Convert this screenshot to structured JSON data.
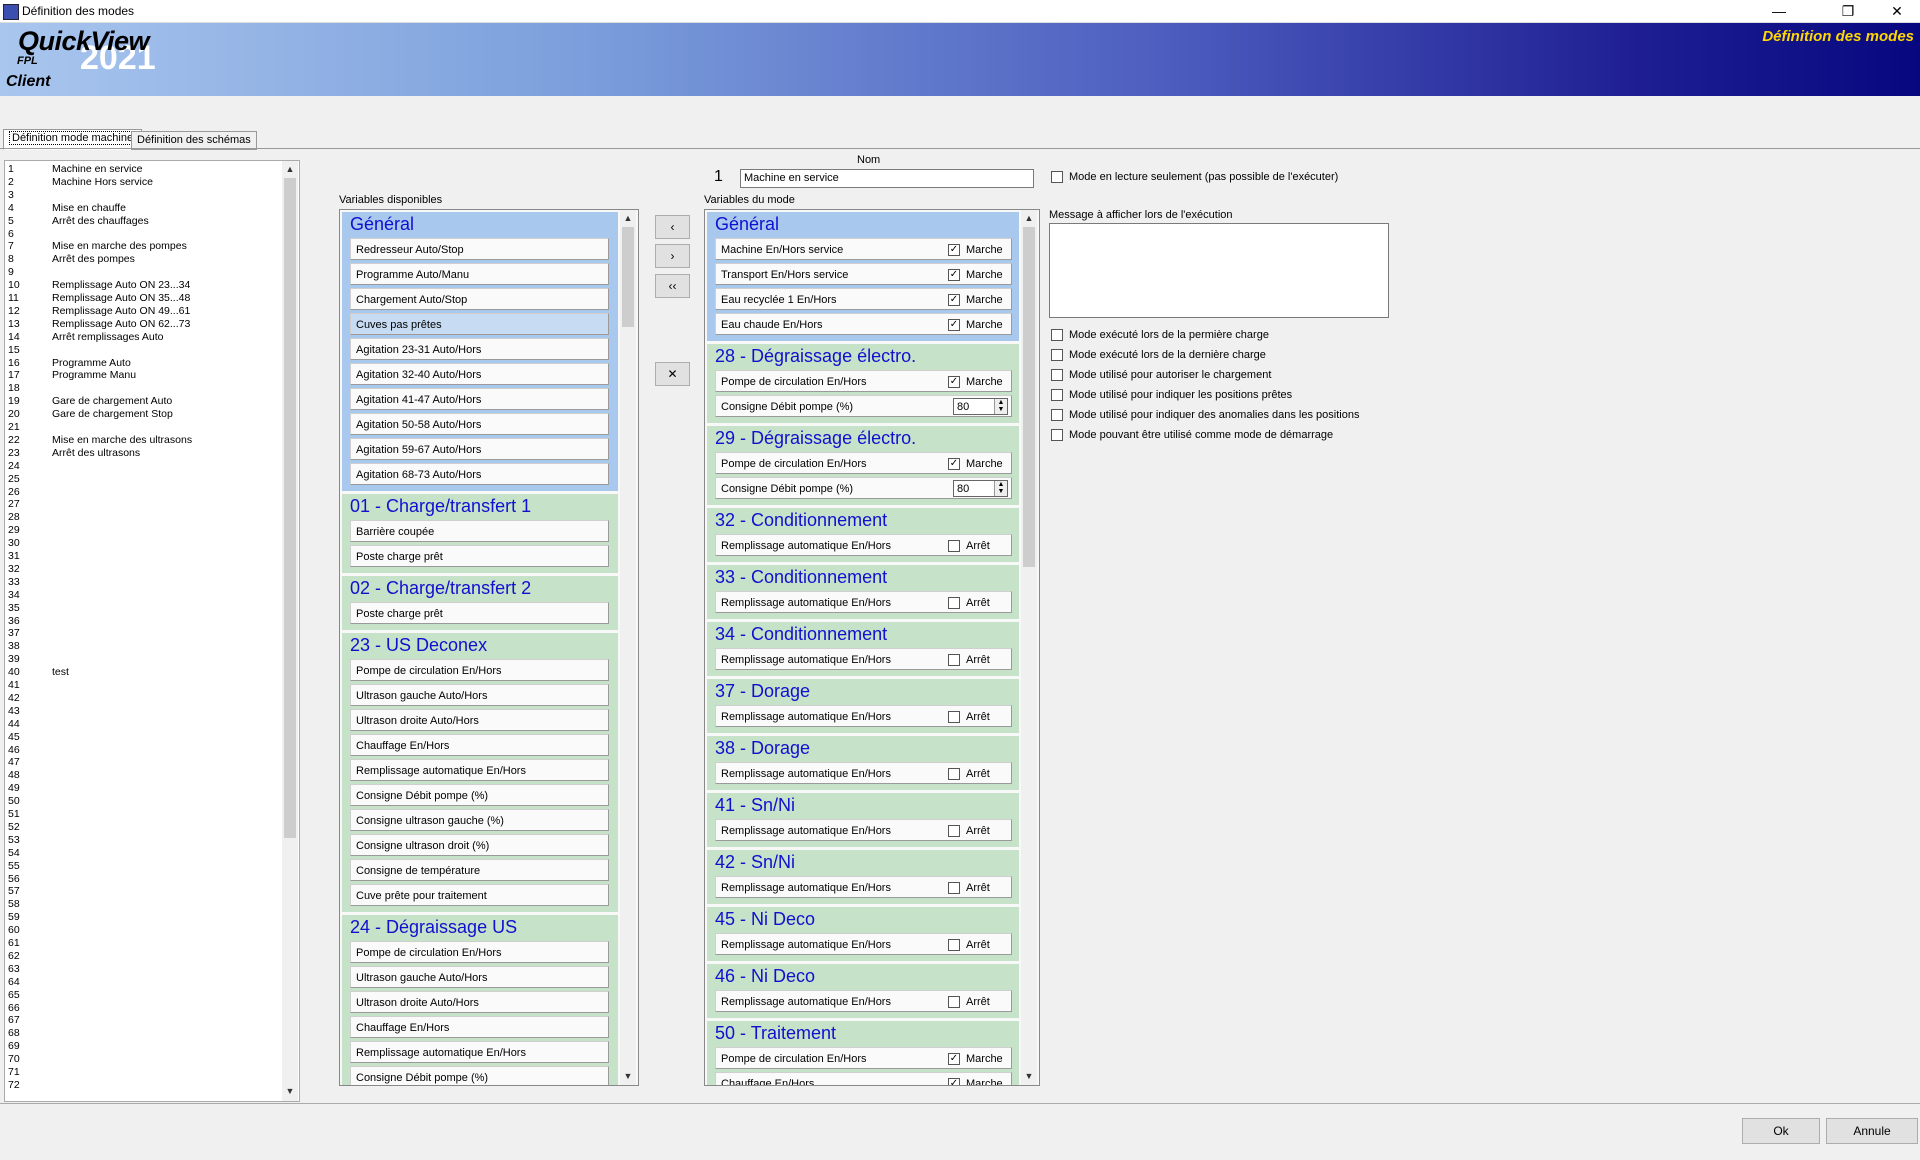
{
  "window": {
    "title": "Définition des modes",
    "minimize": "—",
    "maximize": "❐",
    "close": "✕"
  },
  "banner": {
    "brand": "QuickView",
    "year": "2021",
    "sub": "FPL",
    "role": "Client",
    "page_title": "Définition des modes"
  },
  "tabs": [
    {
      "label": "Définition mode machine"
    },
    {
      "label": "Définition des schémas"
    }
  ],
  "mode_list": [
    {
      "n": "1",
      "name": "Machine en service"
    },
    {
      "n": "2",
      "name": "Machine Hors service"
    },
    {
      "n": "3",
      "name": ""
    },
    {
      "n": "4",
      "name": "Mise en chauffe"
    },
    {
      "n": "5",
      "name": "Arrêt des chauffages"
    },
    {
      "n": "6",
      "name": ""
    },
    {
      "n": "7",
      "name": "Mise en marche des pompes"
    },
    {
      "n": "8",
      "name": "Arrêt des pompes"
    },
    {
      "n": "9",
      "name": ""
    },
    {
      "n": "10",
      "name": "Remplissage Auto ON 23...34"
    },
    {
      "n": "11",
      "name": "Remplissage Auto ON 35...48"
    },
    {
      "n": "12",
      "name": "Remplissage Auto ON 49...61"
    },
    {
      "n": "13",
      "name": "Remplissage Auto ON 62...73"
    },
    {
      "n": "14",
      "name": "Arrêt remplissages Auto"
    },
    {
      "n": "15",
      "name": ""
    },
    {
      "n": "16",
      "name": "Programme Auto"
    },
    {
      "n": "17",
      "name": "Programme Manu"
    },
    {
      "n": "18",
      "name": ""
    },
    {
      "n": "19",
      "name": "Gare de chargement Auto"
    },
    {
      "n": "20",
      "name": "Gare de chargement Stop"
    },
    {
      "n": "21",
      "name": ""
    },
    {
      "n": "22",
      "name": "Mise en marche des ultrasons"
    },
    {
      "n": "23",
      "name": "Arrêt des ultrasons"
    },
    {
      "n": "24",
      "name": ""
    },
    {
      "n": "25",
      "name": ""
    },
    {
      "n": "26",
      "name": ""
    },
    {
      "n": "27",
      "name": ""
    },
    {
      "n": "28",
      "name": ""
    },
    {
      "n": "29",
      "name": ""
    },
    {
      "n": "30",
      "name": ""
    },
    {
      "n": "31",
      "name": ""
    },
    {
      "n": "32",
      "name": ""
    },
    {
      "n": "33",
      "name": ""
    },
    {
      "n": "34",
      "name": ""
    },
    {
      "n": "35",
      "name": ""
    },
    {
      "n": "36",
      "name": ""
    },
    {
      "n": "37",
      "name": ""
    },
    {
      "n": "38",
      "name": ""
    },
    {
      "n": "39",
      "name": ""
    },
    {
      "n": "40",
      "name": "test"
    },
    {
      "n": "41",
      "name": ""
    },
    {
      "n": "42",
      "name": ""
    },
    {
      "n": "43",
      "name": ""
    },
    {
      "n": "44",
      "name": ""
    },
    {
      "n": "45",
      "name": ""
    },
    {
      "n": "46",
      "name": ""
    },
    {
      "n": "47",
      "name": ""
    },
    {
      "n": "48",
      "name": ""
    },
    {
      "n": "49",
      "name": ""
    },
    {
      "n": "50",
      "name": ""
    },
    {
      "n": "51",
      "name": ""
    },
    {
      "n": "52",
      "name": ""
    },
    {
      "n": "53",
      "name": ""
    },
    {
      "n": "54",
      "name": ""
    },
    {
      "n": "55",
      "name": ""
    },
    {
      "n": "56",
      "name": ""
    },
    {
      "n": "57",
      "name": ""
    },
    {
      "n": "58",
      "name": ""
    },
    {
      "n": "59",
      "name": ""
    },
    {
      "n": "60",
      "name": ""
    },
    {
      "n": "61",
      "name": ""
    },
    {
      "n": "62",
      "name": ""
    },
    {
      "n": "63",
      "name": ""
    },
    {
      "n": "64",
      "name": ""
    },
    {
      "n": "65",
      "name": ""
    },
    {
      "n": "66",
      "name": ""
    },
    {
      "n": "67",
      "name": ""
    },
    {
      "n": "68",
      "name": ""
    },
    {
      "n": "69",
      "name": ""
    },
    {
      "n": "70",
      "name": ""
    },
    {
      "n": "71",
      "name": ""
    },
    {
      "n": "72",
      "name": ""
    }
  ],
  "labels": {
    "available": "Variables disponibles",
    "mode_vars": "Variables du mode",
    "name": "Nom",
    "message": "Message à afficher lors de l'exécution"
  },
  "mode_number": "1",
  "mode_name": "Machine en service",
  "readonly_option": "Mode en lecture seulement (pas possible de l'exécuter)",
  "options": [
    "Mode exécuté lors de la permière charge",
    "Mode exécuté lors de la dernière charge",
    "Mode utilisé pour autoriser le chargement",
    "Mode utilisé pour indiquer les positions prêtes",
    "Mode utilisé pour indiquer des anomalies dans les positions",
    "Mode pouvant être utilisé comme mode de démarrage"
  ],
  "transfer_buttons": [
    "‹",
    "›",
    "‹‹",
    "✕"
  ],
  "available_groups": [
    {
      "title": "Général",
      "color": "#a9c8ee",
      "items": [
        "Redresseur Auto/Stop",
        "Programme Auto/Manu",
        "Chargement Auto/Stop",
        "Cuves pas prêtes",
        "Agitation 23-31 Auto/Hors",
        "Agitation 32-40 Auto/Hors",
        "Agitation 41-47 Auto/Hors",
        "Agitation 50-58 Auto/Hors",
        "Agitation 59-67 Auto/Hors",
        "Agitation 68-73 Auto/Hors"
      ],
      "selected": 3
    },
    {
      "title": "01 - Charge/transfert 1",
      "color": "#c6e2c8",
      "items": [
        "Barrière coupée",
        "Poste charge prêt"
      ]
    },
    {
      "title": "02 - Charge/transfert 2",
      "color": "#c6e2c8",
      "items": [
        "Poste charge prêt"
      ]
    },
    {
      "title": "23 - US Deconex",
      "color": "#c6e2c8",
      "items": [
        "Pompe de circulation En/Hors",
        "Ultrason gauche Auto/Hors",
        "Ultrason droite Auto/Hors",
        "Chauffage En/Hors",
        "Remplissage automatique En/Hors",
        "Consigne Débit pompe (%)",
        "Consigne ultrason gauche (%)",
        "Consigne ultrason droit (%)",
        "Consigne de température",
        "Cuve prête pour traitement"
      ]
    },
    {
      "title": "24 - Dégraissage US",
      "color": "#c6e2c8",
      "items": [
        "Pompe de circulation En/Hors",
        "Ultrason gauche Auto/Hors",
        "Ultrason droite Auto/Hors",
        "Chauffage En/Hors",
        "Remplissage automatique En/Hors",
        "Consigne Débit pompe (%)"
      ]
    }
  ],
  "mode_groups": [
    {
      "title": "Général",
      "color": "#a9c8ee",
      "items": [
        {
          "label": "Machine En/Hors service",
          "type": "check",
          "checked": true,
          "state": "Marche"
        },
        {
          "label": "Transport En/Hors service",
          "type": "check",
          "checked": true,
          "state": "Marche"
        },
        {
          "label": "Eau recyclée 1 En/Hors",
          "type": "check",
          "checked": true,
          "state": "Marche"
        },
        {
          "label": "Eau chaude En/Hors",
          "type": "check",
          "checked": true,
          "state": "Marche"
        }
      ]
    },
    {
      "title": "28 - Dégraissage électro.",
      "color": "#c6e2c8",
      "items": [
        {
          "label": "Pompe de circulation En/Hors",
          "type": "check",
          "checked": true,
          "state": "Marche"
        },
        {
          "label": "Consigne Débit pompe (%)",
          "type": "spin",
          "value": "80"
        }
      ]
    },
    {
      "title": "29 - Dégraissage électro.",
      "color": "#c6e2c8",
      "items": [
        {
          "label": "Pompe de circulation En/Hors",
          "type": "check",
          "checked": true,
          "state": "Marche"
        },
        {
          "label": "Consigne Débit pompe (%)",
          "type": "spin",
          "value": "80"
        }
      ]
    },
    {
      "title": "32 - Conditionnement",
      "color": "#c6e2c8",
      "items": [
        {
          "label": "Remplissage automatique En/Hors",
          "type": "check",
          "checked": false,
          "state": "Arrêt"
        }
      ]
    },
    {
      "title": "33 - Conditionnement",
      "color": "#c6e2c8",
      "items": [
        {
          "label": "Remplissage automatique En/Hors",
          "type": "check",
          "checked": false,
          "state": "Arrêt"
        }
      ]
    },
    {
      "title": "34 - Conditionnement",
      "color": "#c6e2c8",
      "items": [
        {
          "label": "Remplissage automatique En/Hors",
          "type": "check",
          "checked": false,
          "state": "Arrêt"
        }
      ]
    },
    {
      "title": "37 - Dorage",
      "color": "#c6e2c8",
      "items": [
        {
          "label": "Remplissage automatique En/Hors",
          "type": "check",
          "checked": false,
          "state": "Arrêt"
        }
      ]
    },
    {
      "title": "38 - Dorage",
      "color": "#c6e2c8",
      "items": [
        {
          "label": "Remplissage automatique En/Hors",
          "type": "check",
          "checked": false,
          "state": "Arrêt"
        }
      ]
    },
    {
      "title": "41 - Sn/Ni",
      "color": "#c6e2c8",
      "items": [
        {
          "label": "Remplissage automatique En/Hors",
          "type": "check",
          "checked": false,
          "state": "Arrêt"
        }
      ]
    },
    {
      "title": "42 - Sn/Ni",
      "color": "#c6e2c8",
      "items": [
        {
          "label": "Remplissage automatique En/Hors",
          "type": "check",
          "checked": false,
          "state": "Arrêt"
        }
      ]
    },
    {
      "title": "45 - Ni Deco",
      "color": "#c6e2c8",
      "items": [
        {
          "label": "Remplissage automatique En/Hors",
          "type": "check",
          "checked": false,
          "state": "Arrêt"
        }
      ]
    },
    {
      "title": "46 - Ni Deco",
      "color": "#c6e2c8",
      "items": [
        {
          "label": "Remplissage automatique En/Hors",
          "type": "check",
          "checked": false,
          "state": "Arrêt"
        }
      ]
    },
    {
      "title": "50 - Traitement",
      "color": "#c6e2c8",
      "items": [
        {
          "label": "Pompe de circulation En/Hors",
          "type": "check",
          "checked": true,
          "state": "Marche"
        },
        {
          "label": "Chauffage En/Hors",
          "type": "check",
          "checked": true,
          "state": "Marche"
        }
      ]
    }
  ],
  "footer": {
    "ok": "Ok",
    "cancel": "Annule"
  }
}
